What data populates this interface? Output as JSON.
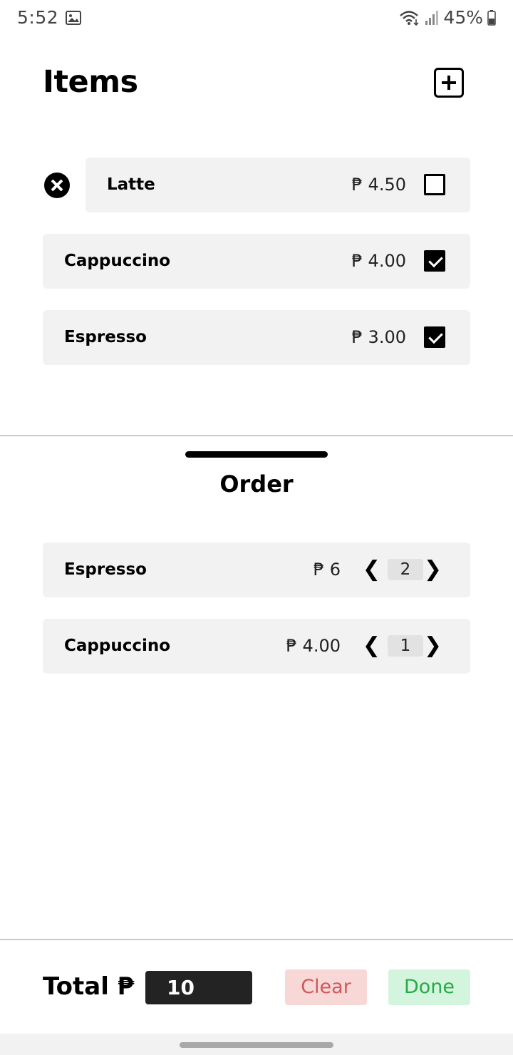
{
  "status_bar": {
    "time": "5:52",
    "battery": "45%",
    "icons": [
      "gallery-icon",
      "wifi-icon",
      "signal-icon",
      "battery-icon"
    ]
  },
  "header": {
    "title": "Items",
    "add_icon": "plus-square-icon"
  },
  "items": [
    {
      "name": "Latte",
      "price": "₱ 4.50",
      "checked": false,
      "swiped": true
    },
    {
      "name": "Cappuccino",
      "price": "₱ 4.00",
      "checked": true
    },
    {
      "name": "Espresso",
      "price": "₱ 3.00",
      "checked": true
    }
  ],
  "order": {
    "title": "Order",
    "rows": [
      {
        "name": "Espresso",
        "price": "₱ 6",
        "quantity": "2"
      },
      {
        "name": "Cappuccino",
        "price": "₱ 4.00",
        "quantity": "1"
      }
    ],
    "dec_symbol": "❮",
    "inc_symbol": "❯"
  },
  "footer": {
    "total_label": "Total ₱",
    "total_value": "10",
    "clear_label": "Clear",
    "done_label": "Done"
  },
  "colors": {
    "row_bg": "#f2f2f2",
    "clear_bg": "#f8d7d7",
    "clear_text": "#d0585b",
    "done_bg": "#d4f5dd",
    "done_text": "#2aa84a",
    "total_bg": "#232323"
  }
}
